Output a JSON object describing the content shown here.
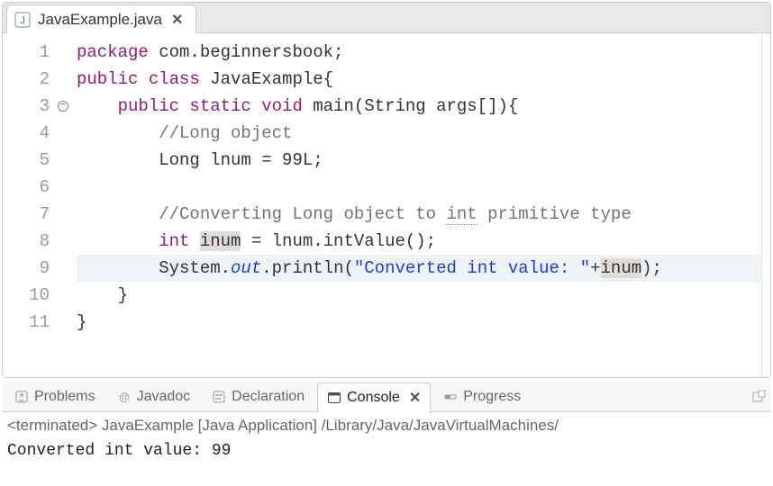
{
  "editor": {
    "tab_filename": "JavaExample.java",
    "highlighted_line_index": 8,
    "fold_marker_line_index": 2,
    "lines": [
      {
        "n": 1,
        "tokens": [
          {
            "t": "package ",
            "c": "kw"
          },
          {
            "t": "com.beginnersbook;"
          }
        ]
      },
      {
        "n": 2,
        "tokens": [
          {
            "t": "public class ",
            "c": "kw"
          },
          {
            "t": "JavaExample{"
          }
        ]
      },
      {
        "n": 3,
        "tokens": [
          {
            "t": "    "
          },
          {
            "t": "public static void ",
            "c": "kw"
          },
          {
            "t": "main(String args[]){"
          }
        ]
      },
      {
        "n": 4,
        "tokens": [
          {
            "t": "        "
          },
          {
            "t": "//Long object",
            "c": "comment"
          }
        ]
      },
      {
        "n": 5,
        "tokens": [
          {
            "t": "        Long lnum = 99L;"
          }
        ]
      },
      {
        "n": 6,
        "tokens": [
          {
            "t": ""
          }
        ]
      },
      {
        "n": 7,
        "tokens": [
          {
            "t": "        "
          },
          {
            "t": "//Converting Long object to ",
            "c": "comment"
          },
          {
            "t": "int",
            "c": "comment dotted-u"
          },
          {
            "t": " primitive type",
            "c": "comment"
          }
        ]
      },
      {
        "n": 8,
        "tokens": [
          {
            "t": "        "
          },
          {
            "t": "int ",
            "c": "kw"
          },
          {
            "t": "inum",
            "c": "occ"
          },
          {
            "t": " = lnum.intValue();"
          }
        ]
      },
      {
        "n": 9,
        "tokens": [
          {
            "t": "        System."
          },
          {
            "t": "out",
            "c": "field"
          },
          {
            "t": ".println("
          },
          {
            "t": "\"Converted int value: \"",
            "c": "str"
          },
          {
            "t": "+"
          },
          {
            "t": "inum",
            "c": "occ"
          },
          {
            "t": ");"
          }
        ]
      },
      {
        "n": 10,
        "tokens": [
          {
            "t": "    }"
          }
        ]
      },
      {
        "n": 11,
        "tokens": [
          {
            "t": "}"
          }
        ]
      }
    ]
  },
  "views": {
    "tabs": [
      {
        "id": "problems",
        "label": "Problems"
      },
      {
        "id": "javadoc",
        "label": "Javadoc"
      },
      {
        "id": "declaration",
        "label": "Declaration"
      },
      {
        "id": "console",
        "label": "Console",
        "active": true
      },
      {
        "id": "progress",
        "label": "Progress"
      }
    ]
  },
  "console": {
    "status": "<terminated> JavaExample [Java Application] /Library/Java/JavaVirtualMachines/",
    "output": "Converted int value: 99"
  }
}
